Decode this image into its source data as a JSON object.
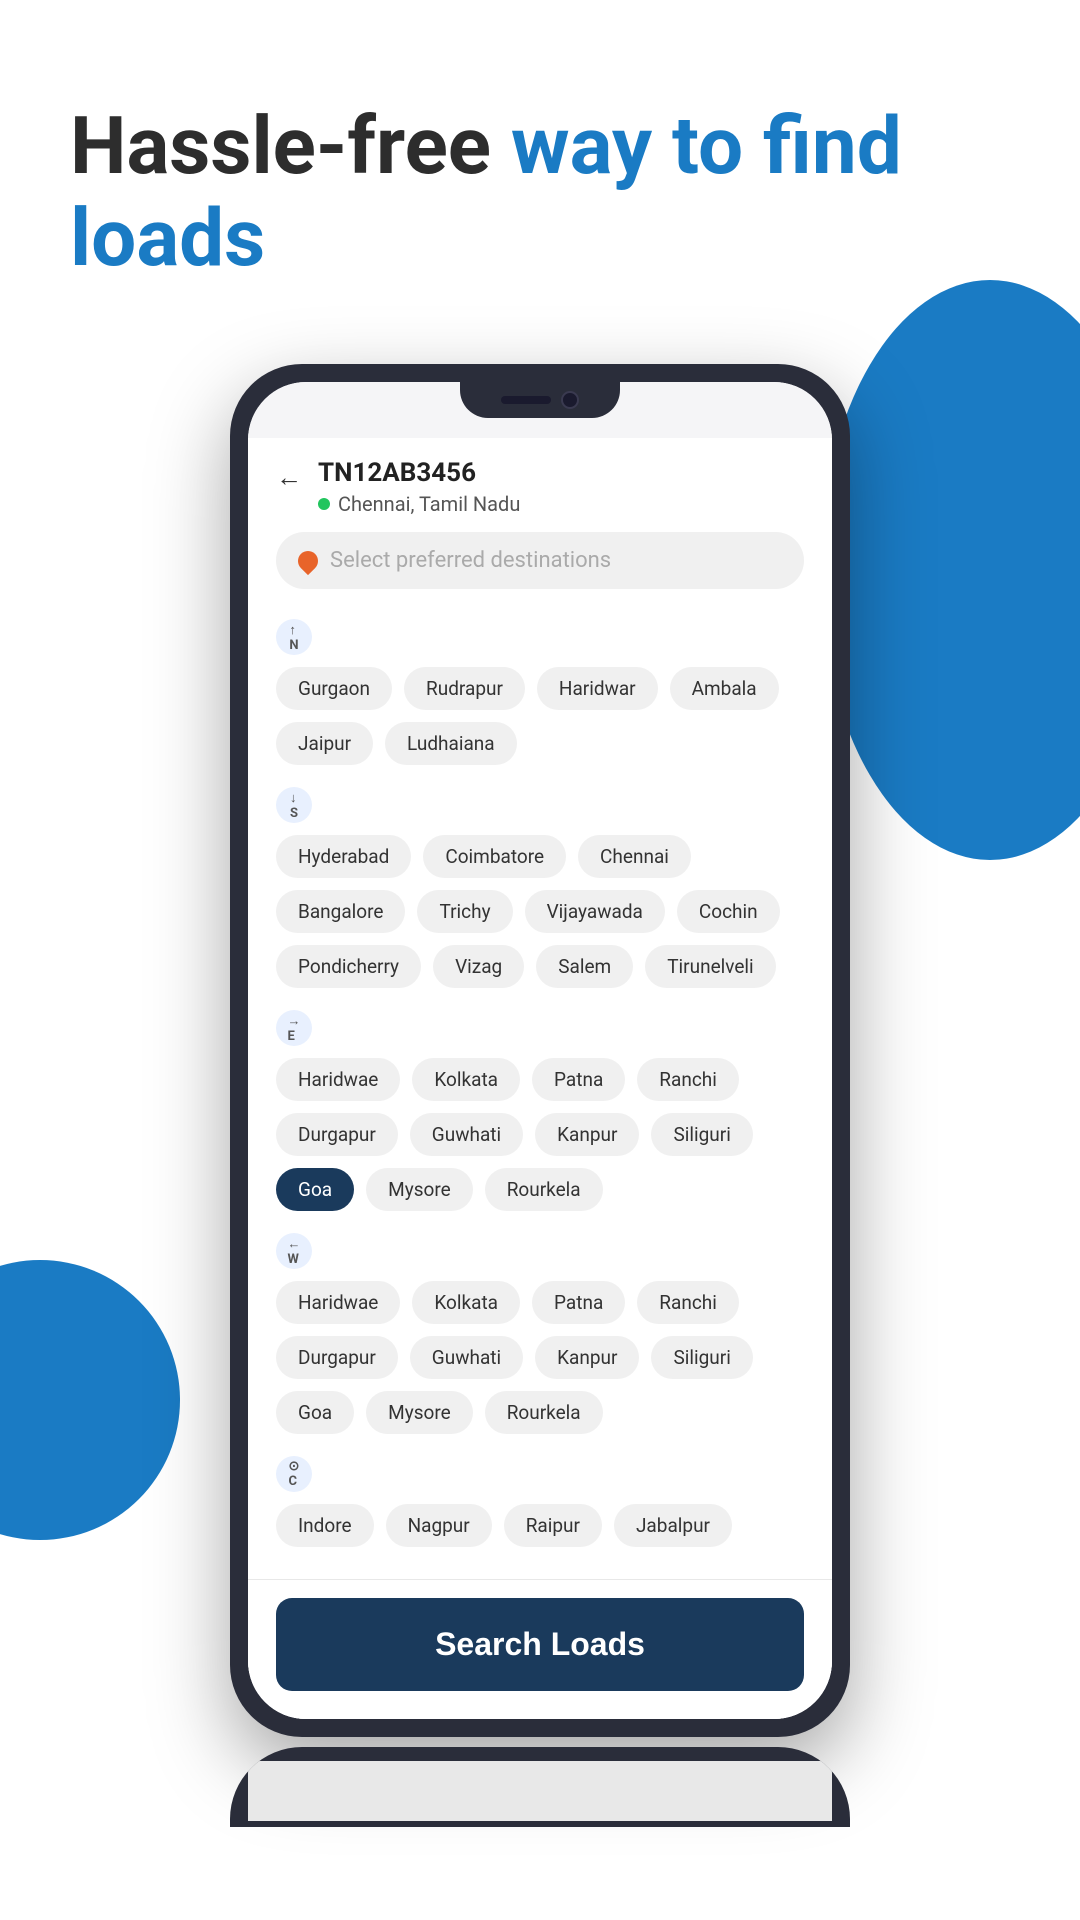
{
  "header": {
    "title_part1": "Hassle-free ",
    "title_part2": "way to find loads"
  },
  "phone": {
    "vehicle_id": "TN12AB3456",
    "location": "Chennai, Tamil Nadu",
    "search_placeholder": "Select preferred destinations",
    "back_label": "←",
    "search_button_label": "Search Loads"
  },
  "directions": [
    {
      "icon": "N",
      "label": "North",
      "chips": [
        "Gurgaon",
        "Rudrapur",
        "Haridwar",
        "Ambala",
        "Jaipur",
        "Ludhaiana"
      ]
    },
    {
      "icon": "S",
      "label": "South",
      "chips": [
        "Hyderabad",
        "Coimbatore",
        "Chennai",
        "Bangalore",
        "Trichy",
        "Vijayawada",
        "Cochin",
        "Pondicherry",
        "Vizag",
        "Salem",
        "Tirunelveli"
      ]
    },
    {
      "icon": "E",
      "label": "East",
      "chips": [
        "Haridwae",
        "Kolkata",
        "Patna",
        "Ranchi",
        "Durgapur",
        "Guwhati",
        "Kanpur",
        "Siliguri",
        "Goa",
        "Mysore",
        "Rourkela"
      ]
    },
    {
      "icon": "W",
      "label": "West",
      "chips": [
        "Haridwae",
        "Kolkata",
        "Patna",
        "Ranchi",
        "Durgapur",
        "Guwhati",
        "Kanpur",
        "Siliguri",
        "Goa",
        "Mysore",
        "Rourkela"
      ]
    },
    {
      "icon": "C",
      "label": "Central",
      "chips": [
        "Indore",
        "Nagpur",
        "Raipur",
        "Jabalpur"
      ]
    }
  ],
  "selected_chips": [
    "Goa"
  ],
  "colors": {
    "blue_accent": "#1a7bc4",
    "dark_navy": "#1a3a5c",
    "green_dot": "#22c55e",
    "orange_pin": "#e8642a"
  }
}
